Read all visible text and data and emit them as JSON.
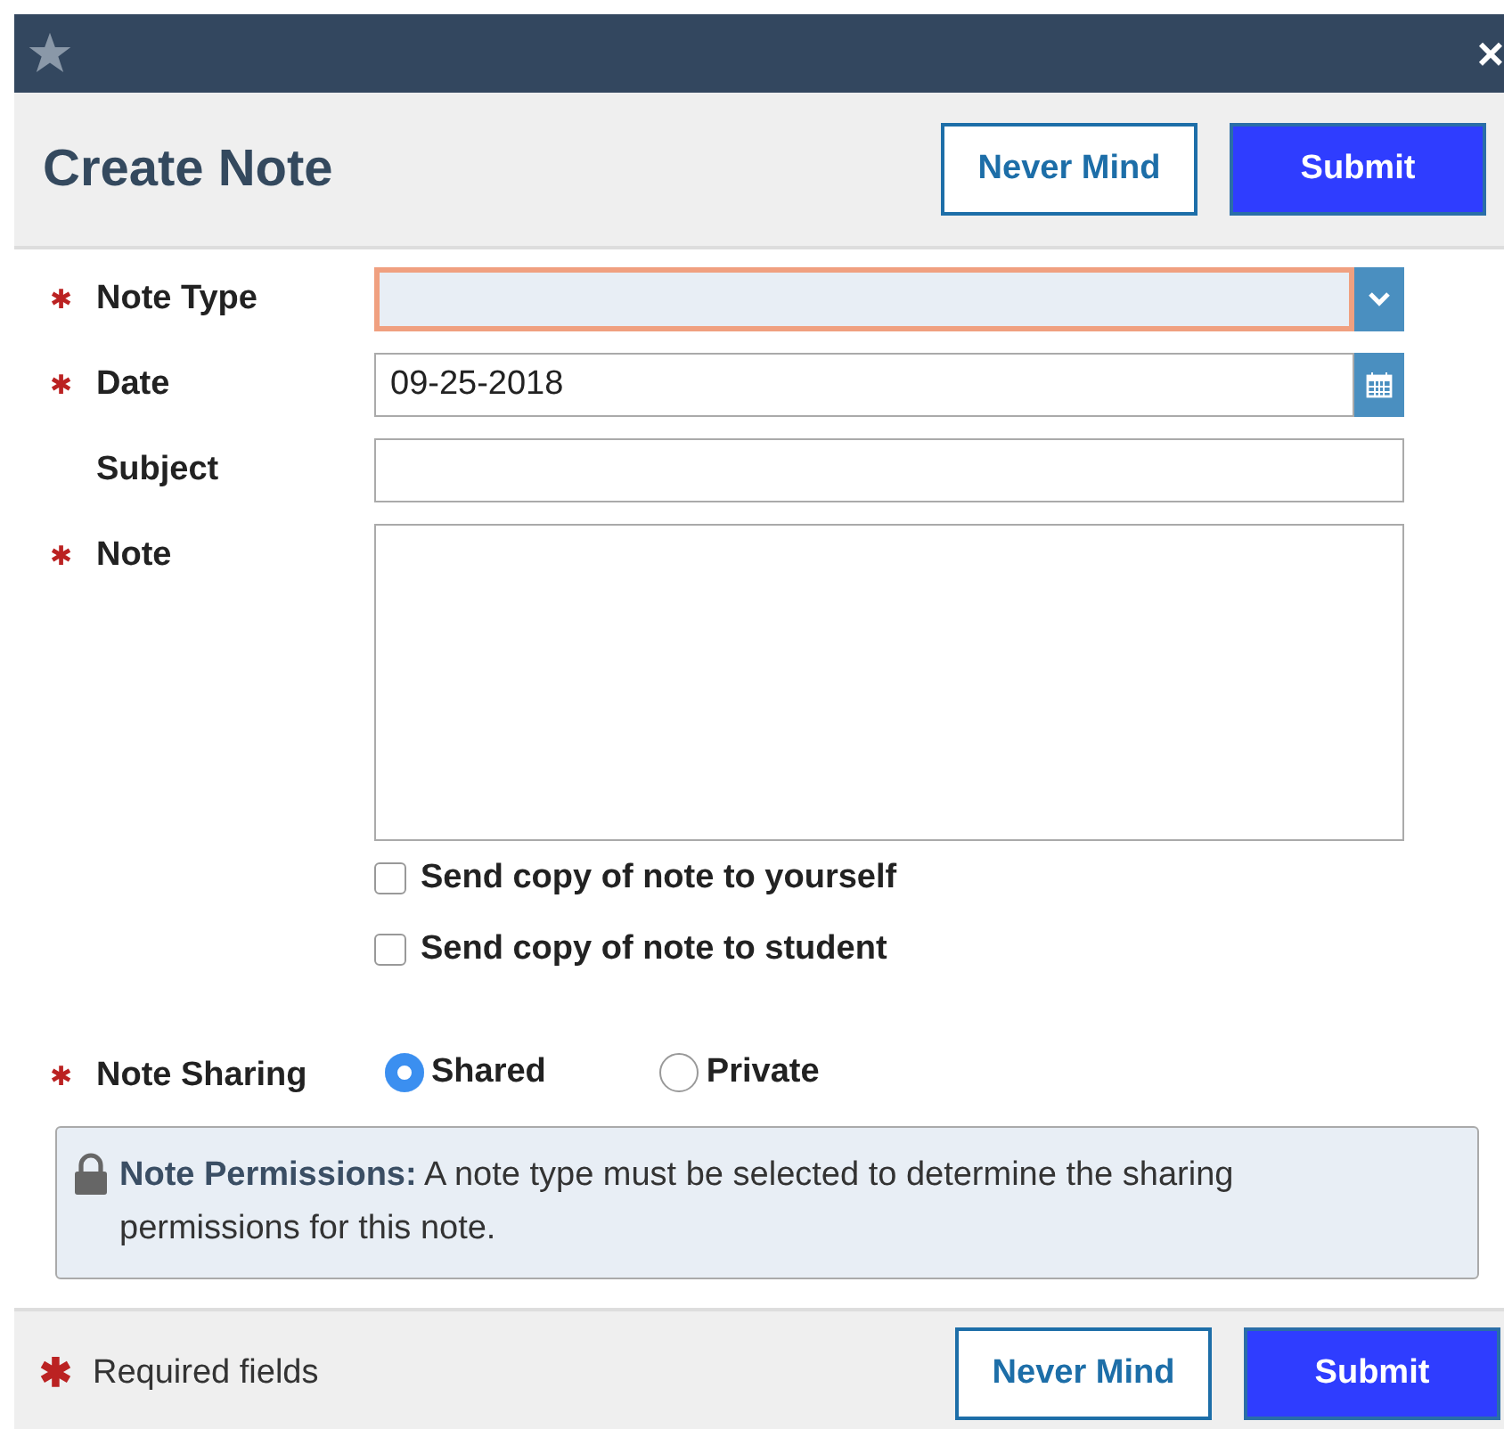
{
  "window": {
    "close": "×"
  },
  "header": {
    "title": "Create Note",
    "buttons": [
      {
        "label": "Never Mind",
        "kind": "secondary"
      },
      {
        "label": "Submit",
        "kind": "primary"
      }
    ]
  },
  "fields": [
    {
      "label": "Note Type",
      "marker": "✱",
      "kind": "select",
      "focused": true
    },
    {
      "label": "Date",
      "marker": "✱",
      "kind": "date",
      "value": "09-25-2018",
      "focused": false
    },
    {
      "label": "Subject",
      "kind": "text",
      "focused": false
    },
    {
      "label": "Note",
      "marker": "✱",
      "kind": "textarea",
      "focused": false
    }
  ],
  "checkboxes": [
    {
      "label": "Send copy of note to yourself",
      "checked": false
    },
    {
      "label": "Send copy of note to student",
      "checked": false
    }
  ],
  "sharing": {
    "label": "Note Sharing",
    "marker": "✱",
    "options": [
      {
        "label": "Shared",
        "selected": true
      },
      {
        "label": "Private",
        "selected": false
      }
    ]
  },
  "notice": {
    "text": "**Note Permissions:** A note type must be selected to determine the sharing permissions for this note."
  },
  "footer": {
    "marker": "✱",
    "legend": "Required fields",
    "buttons": [
      {
        "label": "Never Mind",
        "kind": "secondary"
      },
      {
        "label": "Submit",
        "kind": "primary"
      }
    ]
  }
}
